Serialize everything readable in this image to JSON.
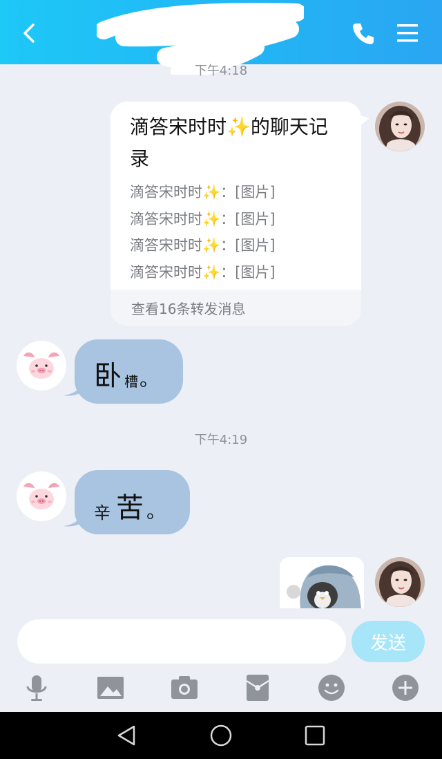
{
  "header": {
    "title_obscured": "",
    "back_icon": "chevron-left-icon",
    "call_icon": "phone-icon",
    "menu_icon": "hamburger-menu-icon",
    "background_color": "#1ec8f7"
  },
  "messages": {
    "time_1": "下午4:18",
    "forward_card": {
      "title_part1": "滴答宋时时",
      "title_part2": "的聊天记录",
      "lines": [
        {
          "sender": "滴答宋时时",
          "content": "：[图片]"
        },
        {
          "sender": "滴答宋时时",
          "content": "：[图片]"
        },
        {
          "sender": "滴答宋时时",
          "content": "：[图片]"
        },
        {
          "sender": "滴答宋时时",
          "content": "：[图片]"
        }
      ],
      "footer": "查看16条转发消息",
      "sparkle_emoji": "✨"
    },
    "bubble_1": {
      "big": "卧",
      "small": "槽",
      "end": "。"
    },
    "time_2": "下午4:19",
    "bubble_2": {
      "small": "辛",
      "big": "苦",
      "end": "。"
    },
    "bubble_color": "#a9c4e1"
  },
  "composer": {
    "input_value": "",
    "input_placeholder": "",
    "send_label": "发送",
    "send_color": "#a7e5f9"
  },
  "toolbar": {
    "items": [
      "microphone-icon",
      "image-icon",
      "camera-icon",
      "red-packet-icon",
      "emoji-icon",
      "plus-icon"
    ]
  },
  "navbar": {
    "items": [
      "back-triangle-icon",
      "home-circle-icon",
      "recents-square-icon"
    ]
  }
}
